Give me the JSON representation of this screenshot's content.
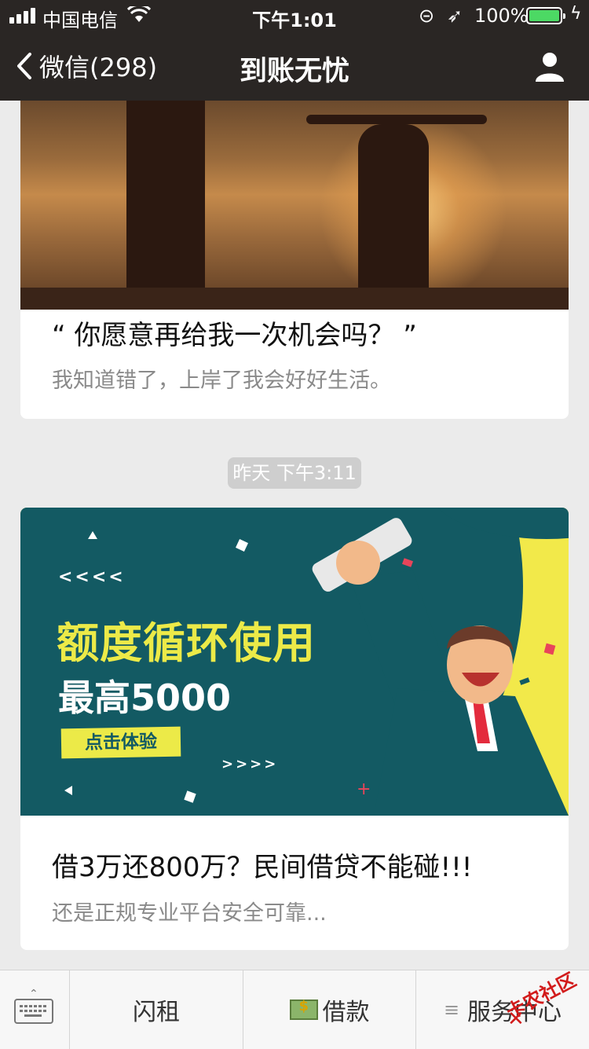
{
  "status_bar": {
    "carrier": "中国电信",
    "time": "下午1:01",
    "battery": "100%"
  },
  "nav": {
    "back_label": "微信(298)",
    "title": "到账无忧"
  },
  "feed": {
    "article1": {
      "title": "“ 你愿意再给我一次机会吗？ ”",
      "digest": "我知道错了，上岸了我会好好生活。"
    },
    "timestamp": "昨天 下午3:11",
    "article2": {
      "banner": {
        "arrows_left": "<<<<",
        "headline": "额度循环使用",
        "subline": "最高5000",
        "cta": "点击体验",
        "arrows_right": ">>>>"
      },
      "title": "借3万还800万？民间借贷不能碰!!!",
      "digest": "还是正规专业平台安全可靠..."
    }
  },
  "menu": {
    "item1": "闪租",
    "item2": "借款",
    "item3": "服务中心"
  },
  "watermark": "卡农社区",
  "colors": {
    "accent_green": "#4cd964",
    "banner_teal": "#135a63",
    "banner_yellow": "#f2e94a"
  }
}
